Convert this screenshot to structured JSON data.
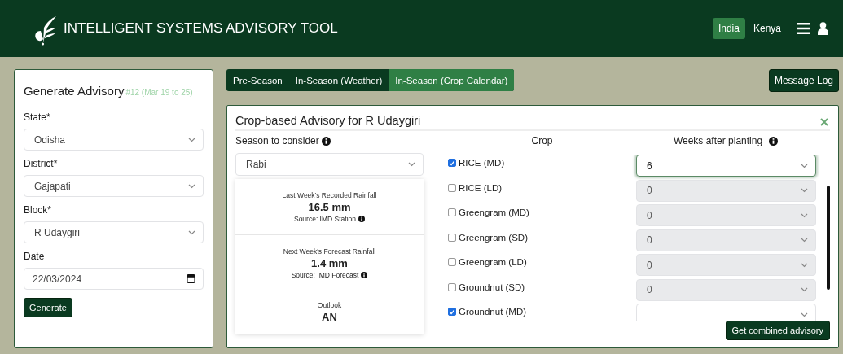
{
  "header": {
    "title": "INTELLIGENT SYSTEMS ADVISORY TOOL",
    "countries": [
      {
        "label": "India",
        "selected": true
      },
      {
        "label": "Kenya",
        "selected": false
      }
    ]
  },
  "sidebar": {
    "title": "Generate Advisory",
    "week": "#12 (Mar 19 to 25)",
    "fields": [
      {
        "kind": "select",
        "label": "State*",
        "value": "Odisha"
      },
      {
        "kind": "select",
        "label": "District*",
        "value": "Gajapati"
      },
      {
        "kind": "select",
        "label": "Block*",
        "value": "R Udaygiri"
      },
      {
        "kind": "date",
        "label": "Date",
        "value": "22/03/2024"
      }
    ],
    "button": "Generate"
  },
  "tabs": [
    {
      "label": "Pre-Season",
      "selected": false
    },
    {
      "label": "In-Season (Weather)",
      "selected": false
    },
    {
      "label": "In-Season (Crop Calendar)",
      "selected": true
    }
  ],
  "message_log": "Message Log",
  "panel": {
    "title": "Crop-based Advisory for R Udaygiri",
    "season": {
      "label": "Season to consider",
      "value": "Rabi"
    },
    "stats": [
      {
        "label": "Last Week's Recorded Rainfall",
        "value": "16.5 mm",
        "source": "Source: IMD Station"
      },
      {
        "label": "Next Week's Forecast Rainfall",
        "value": "1.4 mm",
        "source": "Source: IMD Forecast"
      },
      {
        "label": "Outlook",
        "value": "AN"
      }
    ],
    "crop_header": "Crop",
    "weeks_header": "Weeks after planting",
    "crops": [
      {
        "name": "RICE (MD)",
        "checked": true,
        "focused": true,
        "weeks": "6"
      },
      {
        "name": "RICE (LD)",
        "checked": false,
        "focused": false,
        "weeks": "0"
      },
      {
        "name": "Greengram (MD)",
        "checked": false,
        "focused": false,
        "weeks": "0"
      },
      {
        "name": "Greengram (SD)",
        "checked": false,
        "focused": false,
        "weeks": "0"
      },
      {
        "name": "Greengram (LD)",
        "checked": false,
        "focused": false,
        "weeks": "0"
      },
      {
        "name": "Groundnut (SD)",
        "checked": false,
        "focused": false,
        "weeks": "0"
      },
      {
        "name": "Groundnut (MD)",
        "checked": true,
        "focused": false
      }
    ],
    "button": "Get combined advisory"
  }
}
